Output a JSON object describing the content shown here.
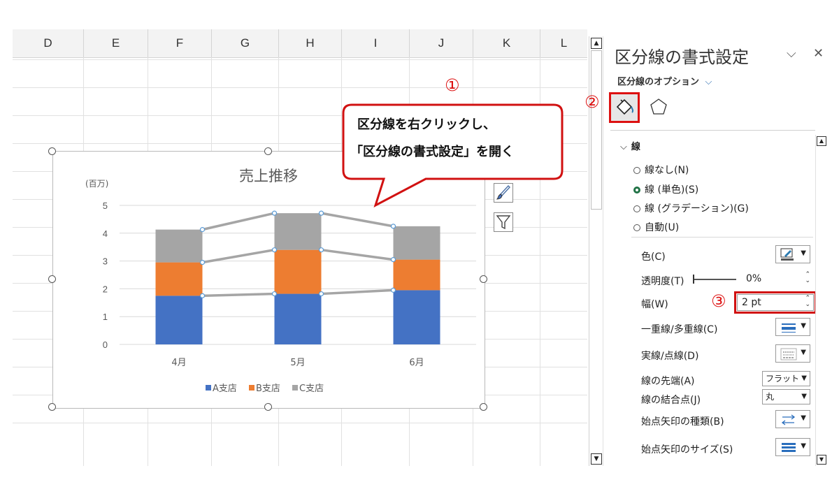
{
  "sheet": {
    "columns": [
      "D",
      "E",
      "F",
      "G",
      "H",
      "I",
      "J",
      "K",
      "L"
    ]
  },
  "chart_data": {
    "type": "bar",
    "stacked": true,
    "title": "売上推移",
    "unit_label": "(百万)",
    "categories": [
      "4月",
      "5月",
      "6月"
    ],
    "series": [
      {
        "name": "A支店",
        "color": "#4472c4",
        "values": [
          1.75,
          1.82,
          1.95
        ]
      },
      {
        "name": "B支店",
        "color": "#ed7d31",
        "values": [
          1.2,
          1.58,
          1.1
        ]
      },
      {
        "name": "C支店",
        "color": "#a5a5a5",
        "values": [
          1.18,
          1.32,
          1.2
        ]
      }
    ],
    "ylim": [
      0,
      5
    ],
    "yticks": [
      "0",
      "1",
      "2",
      "3",
      "4",
      "5"
    ],
    "series_lines": true,
    "series_line_color": "#a5a5a5",
    "legend_position": "bottom",
    "grid": true
  },
  "callout": {
    "line1": "区分線を右クリックし、",
    "line2": "「区分線の書式設定」を開く"
  },
  "annotations": {
    "one": "①",
    "two": "②",
    "three": "③",
    "color": "#d11111"
  },
  "pane": {
    "title": "区分線の書式設定",
    "options_label": "区分線のオプション",
    "section": "線",
    "radios": [
      {
        "label": "線なし(N)",
        "selected": false
      },
      {
        "label": "線 (単色)(S)",
        "selected": true
      },
      {
        "label": "線 (グラデーション)(G)",
        "selected": false
      },
      {
        "label": "自動(U)",
        "selected": false
      }
    ],
    "props": {
      "color": "色(C)",
      "transparency": "透明度(T)",
      "transparency_value": "0%",
      "width": "幅(W)",
      "width_value": "2 pt",
      "compound": "一重線/多重線(C)",
      "dash": "実線/点線(D)",
      "cap": "線の先端(A)",
      "cap_value": "フラット",
      "join": "線の結合点(J)",
      "join_value": "丸",
      "begin_arrow_type": "始点矢印の種類(B)",
      "begin_arrow_size": "始点矢印のサイズ(S)"
    }
  }
}
